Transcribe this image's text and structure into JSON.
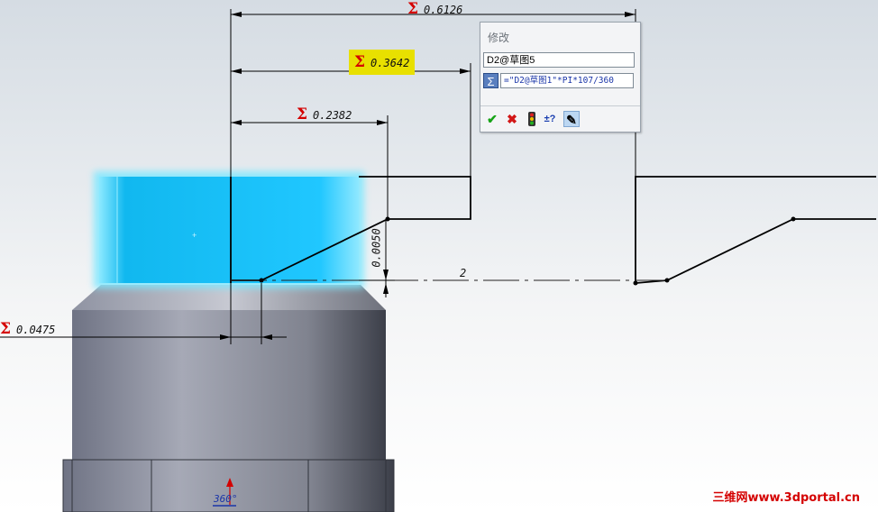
{
  "dimensions": {
    "d_top": "0.6126",
    "d_highlight": "0.3642",
    "d_mid": "0.2382",
    "d_vert": "0.0050",
    "d_left": "0.0475",
    "d_axis": "2",
    "d_bottom": "360°"
  },
  "dialog": {
    "title": "修改",
    "dimension_name": "D2@草图5",
    "expression": "=\"D2@草图1\"*PI*107/360",
    "sum_icon": "Σ",
    "buttons": [
      {
        "name": "ok",
        "icon": "check-icon",
        "glyph": "✔"
      },
      {
        "name": "cancel",
        "icon": "x-icon",
        "glyph": "✖"
      },
      {
        "name": "rebuild",
        "icon": "traffic-light-icon",
        "glyph": ""
      },
      {
        "name": "reverse",
        "icon": "plus-minus-question-icon",
        "glyph": "±?"
      },
      {
        "name": "mark-drawing",
        "icon": "pencil-ruler-icon",
        "glyph": "✎"
      }
    ]
  },
  "watermark": "三维网www.3dportal.cn",
  "colors": {
    "sigma": "#d40000",
    "highlight": "#e8e000",
    "selected_face": "#1ec8ff",
    "body": "#7e8290"
  }
}
